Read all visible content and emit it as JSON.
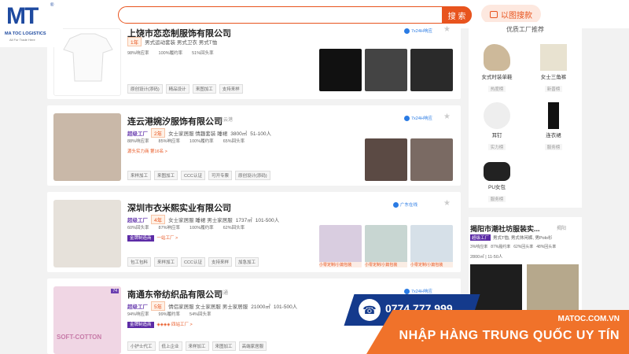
{
  "logo": {
    "mark": "MT",
    "name": "MA TOC LOGISTICS",
    "sub": "All For Trade Here"
  },
  "search": {
    "button": "搜 索",
    "image_search": "以图搜款"
  },
  "cards": [
    {
      "title": "上饶市恋恋制服饰有限公司",
      "loc": "上饶",
      "factory": "超级工厂",
      "year": "1年",
      "cats": "男式运动套装 男式卫衣 男式T恤",
      "m": [
        "98%响应率",
        "100%履约率",
        "51%回头率"
      ],
      "tags": [
        "原创设计(添码)",
        "精品设计",
        "来图加工",
        "支持来样"
      ],
      "chat": "7x24H响应"
    },
    {
      "title": "连云港婉汐服饰有限公司",
      "loc": "连云港",
      "factory": "超级工厂",
      "year": "2年",
      "cats": "女士家居服 情趣套装 睡裙",
      "area": "3800㎡",
      "staff": "51-100人",
      "m": [
        "88%响应率",
        "85%响应率",
        "100%履约率",
        "65%回头率"
      ],
      "level": "源头实力商 第16名 >",
      "tags": [
        "来样加工",
        "来图加工",
        "CCC认证",
        "可开专票",
        "原创设计(添码)"
      ],
      "chat": "7x24H响应"
    },
    {
      "title": "深圳市衣米熙实业有限公司",
      "loc": "揭阳",
      "factory": "超级工厂",
      "year": "4年",
      "cats": "女士家居服 睡裙 男士家居服",
      "area": "1737㎡",
      "staff": "101-500人",
      "m": [
        "60%回头率",
        "87%响应率",
        "100%履约率",
        "62%回头率"
      ],
      "level_tag": "金牌制造商",
      "level": "一站工厂 >",
      "tags": [
        "包工包料",
        "来样加工",
        "CCC认证",
        "支持来样",
        "加急加工"
      ],
      "chat": "广东在线",
      "ptag": "小零定制/小篇包装"
    },
    {
      "title": "南通东帝纺织品有限公司",
      "loc": "南通",
      "factory": "超级工厂",
      "year": "5年",
      "cats": "情侣家居服 女士家居服 男士家居服",
      "area": "21000㎡",
      "staff": "101-500人",
      "m": [
        "94%响应率",
        "99%履约率",
        "54%回头率"
      ],
      "level_tag": "金牌制造商",
      "level": "◈◈◈◈ 四站工厂 >",
      "tags": [
        "小护士代工",
        "低上企业",
        "来样加工",
        "来图加工",
        "高端家居服"
      ],
      "chat": "7x24H响应",
      "photo_label": "SOFT-COTTON",
      "badge": "74"
    }
  ],
  "right": {
    "title": "优质工厂推荐",
    "items": [
      {
        "name": "女式时装单鞋",
        "status": "热度榜"
      },
      {
        "name": "女士三角裤",
        "status": "新晋榜"
      },
      {
        "name": "耳钉",
        "status": "实力榜"
      },
      {
        "name": "连衣裙",
        "status": "服务榜"
      },
      {
        "name": "PU女包",
        "status": "服务榜"
      }
    ]
  },
  "rcard": {
    "title": "揭阳市潮社坊服装实...",
    "loc": "揭阳",
    "factory": "超级工厂",
    "cats": "男式T恤, 男式休闲裤, 男Polo衫",
    "m": [
      "3%响应率",
      "87%履约率",
      "62%回头率",
      "48%回头率"
    ],
    "area": "2800㎡ | 11-50人"
  },
  "contact": {
    "phone": "0774 777 999",
    "site": "MATOC.COM.VN",
    "slogan": "NHẬP HÀNG TRUNG QUỐC UY TÍN"
  }
}
